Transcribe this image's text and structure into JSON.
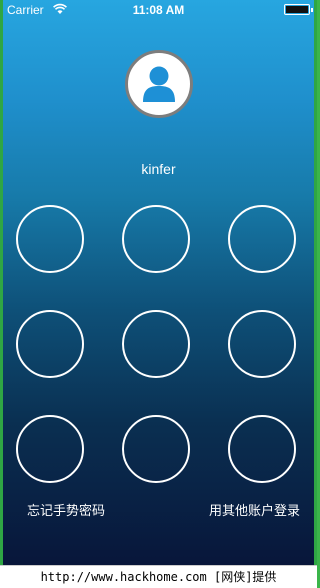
{
  "status_bar": {
    "carrier": "Carrier",
    "wifi_icon": "wifi-icon",
    "time": "11:08 AM",
    "battery_icon": "battery-icon"
  },
  "profile": {
    "avatar_icon": "user-icon",
    "username": "kinfer"
  },
  "gesture_pad": {
    "dots": 9
  },
  "footer_links": {
    "forgot": "忘记手势密码",
    "other_account": "用其他账户登录"
  },
  "watermark": "http://www.hackhome.com [网侠]提供",
  "colors": {
    "gradient_top": "#27a6e0",
    "gradient_bottom": "#08163a",
    "avatar_icon": "#1e90d6"
  }
}
